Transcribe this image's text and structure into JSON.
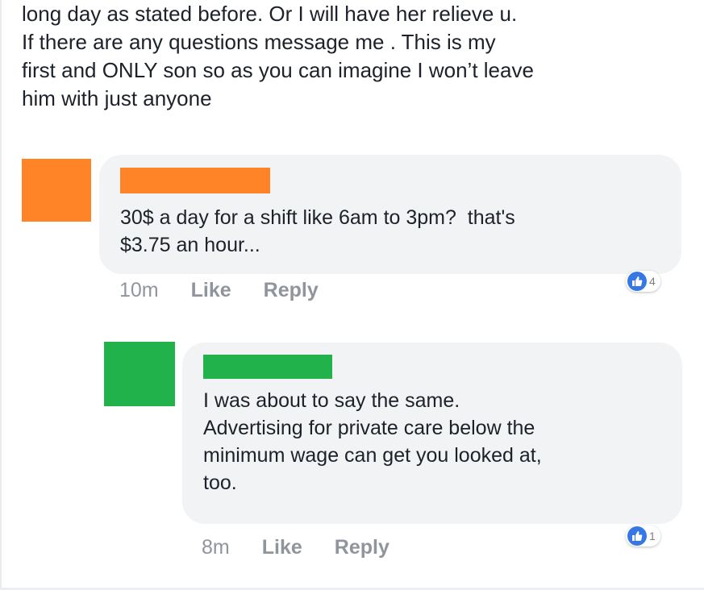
{
  "post": {
    "text": "long day as stated before. Or I will have her relieve u.\nIf there are any questions message me . This is my\nfirst and ONLY son so as you can imagine I won’t leave\nhim with just anyone"
  },
  "comments": [
    {
      "avatar_color": "#ff8427",
      "name_color": "#ff8427",
      "text": "30$ a day for a shift like 6am to 3pm?  that's\n$3.75 an hour...",
      "time": "10m",
      "like_label": "Like",
      "reply_label": "Reply",
      "reaction_count": "4"
    },
    {
      "avatar_color": "#22b24c",
      "name_color": "#22b24c",
      "text": "I was about to say the same.\nAdvertising for private care below the\nminimum wage can get you looked at,\ntoo.",
      "time": "8m",
      "like_label": "Like",
      "reply_label": "Reply",
      "reaction_count": "1"
    }
  ],
  "colors": {
    "bubble": "#f2f3f5",
    "meta_text": "#90949c",
    "like_blue": "#3578e5"
  }
}
